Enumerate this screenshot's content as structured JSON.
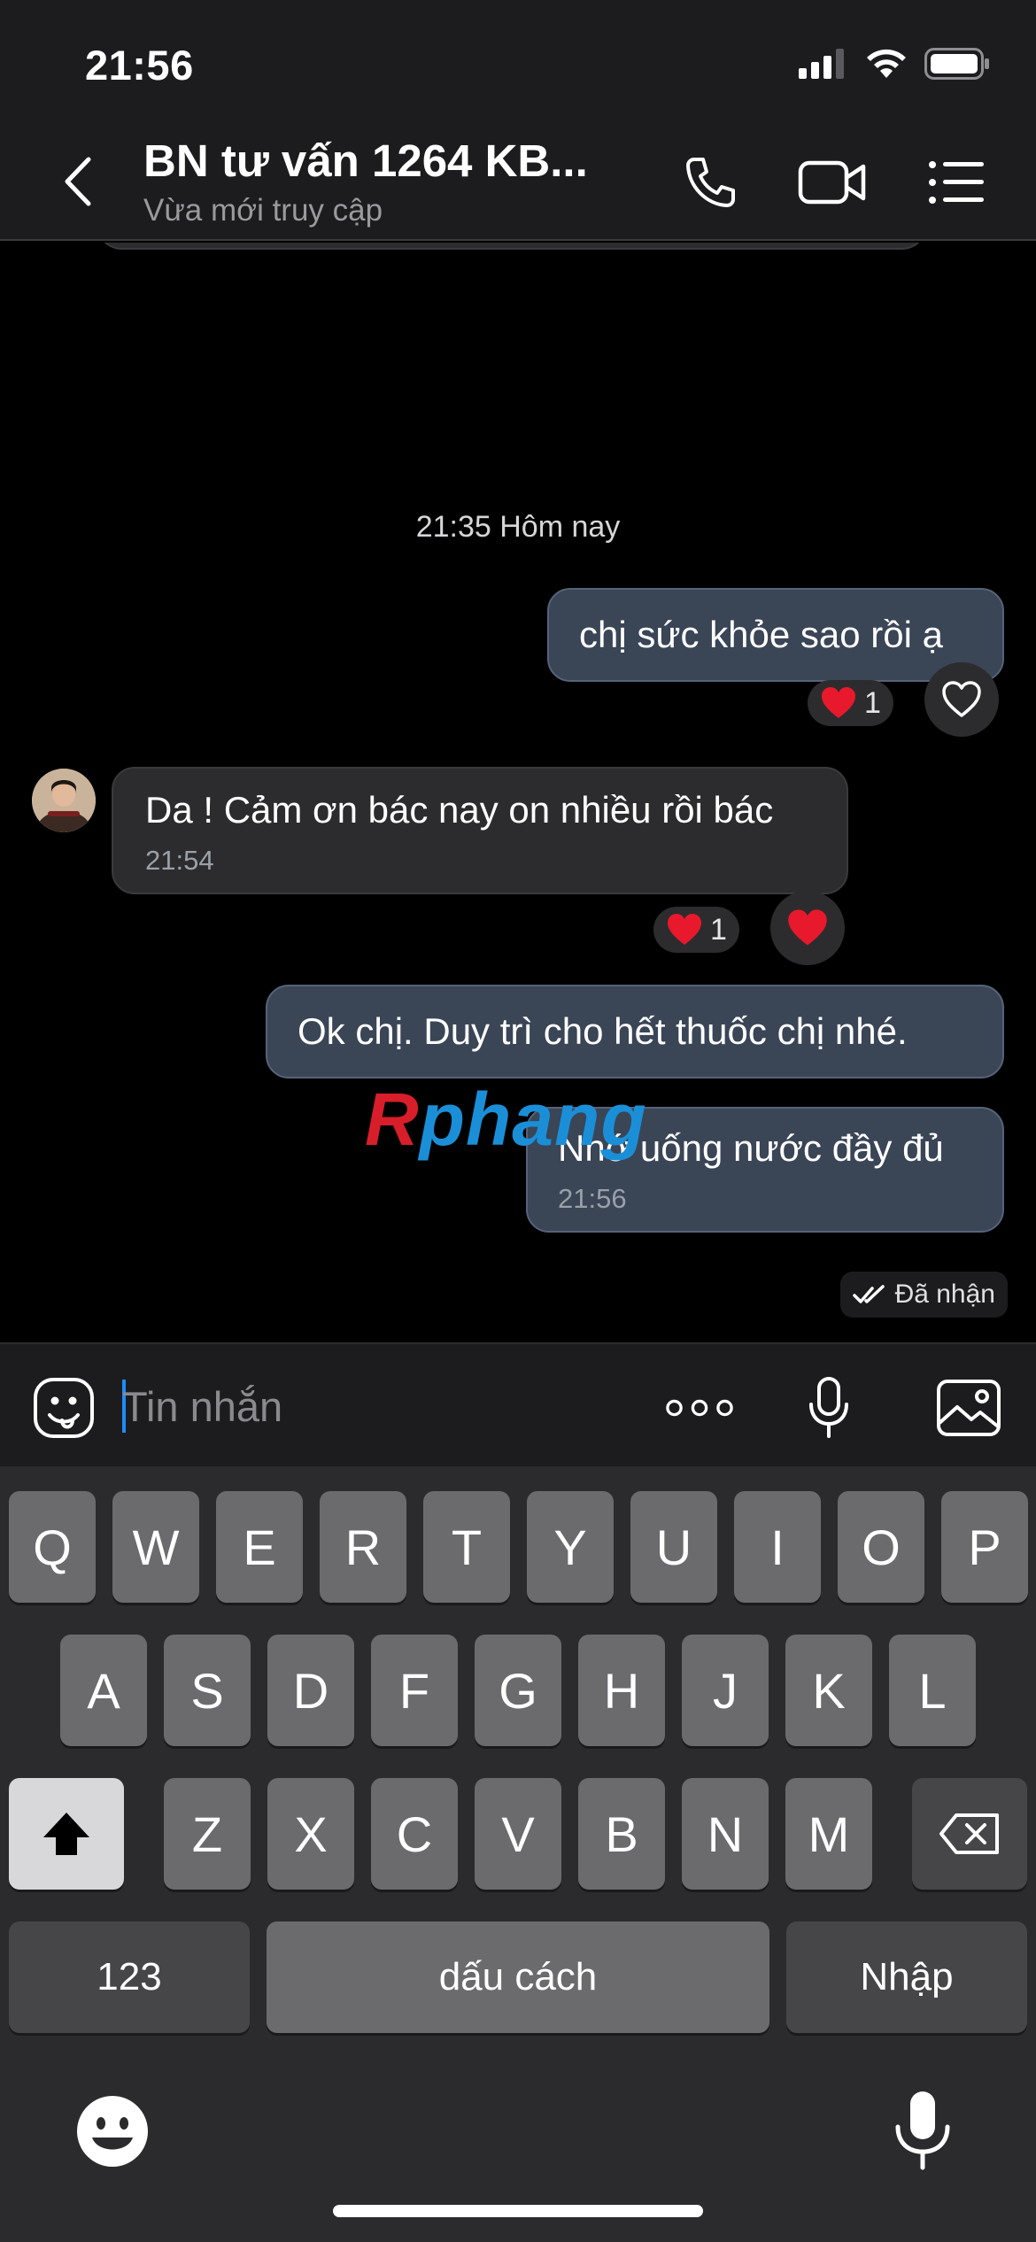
{
  "status_bar": {
    "time": "21:56",
    "battery_icon": "battery-icon",
    "wifi_icon": "wifi-icon",
    "signal_icon": "signal-icon"
  },
  "header": {
    "contact_name": "BN tư vấn 1264 KB...",
    "contact_status": "Vừa mới truy cập",
    "icons": [
      "back-chevron-icon",
      "phone-icon",
      "video-camera-icon",
      "menu-list-icon"
    ]
  },
  "messages": {
    "date_separator": "21:35 Hôm nay",
    "items": [
      {
        "direction": "sent",
        "text": "chị sức khỏe sao rồi ạ",
        "reaction": {
          "emoji": "❤️",
          "count": "1"
        }
      },
      {
        "direction": "received",
        "text": "Da ! Cảm ơn bác nay on nhiều rồi bác",
        "time": "21:54",
        "reaction": {
          "emoji": "❤️",
          "count": "1"
        }
      },
      {
        "direction": "sent",
        "text": "Ok chị. Duy trì cho hết thuốc chị nhé."
      },
      {
        "direction": "sent",
        "text": "Nhớ uống nước đầy đủ",
        "time": "21:56"
      }
    ],
    "delivery_status": "Đã nhận",
    "watermark": {
      "first": "R",
      "rest": "phang"
    }
  },
  "composer": {
    "placeholder": "Tin nhắn",
    "icons": [
      "sticker-icon",
      "more-dots-icon",
      "microphone-icon",
      "image-icon"
    ]
  },
  "keyboard": {
    "row1": [
      "Q",
      "W",
      "E",
      "R",
      "T",
      "Y",
      "U",
      "I",
      "O",
      "P"
    ],
    "row2": [
      "A",
      "S",
      "D",
      "F",
      "G",
      "H",
      "J",
      "K",
      "L"
    ],
    "row3": [
      "Z",
      "X",
      "C",
      "V",
      "B",
      "N",
      "M"
    ],
    "numbers_key": "123",
    "space_key": "dấu cách",
    "return_key": "Nhập",
    "icons": [
      "shift-icon",
      "backspace-icon",
      "emoji-icon",
      "dictation-mic-icon"
    ]
  },
  "colors": {
    "sent_bubble": "#3a4556",
    "received_bubble": "#2c2c2e",
    "accent": "#1e8cff",
    "heart": "#e8192c"
  }
}
